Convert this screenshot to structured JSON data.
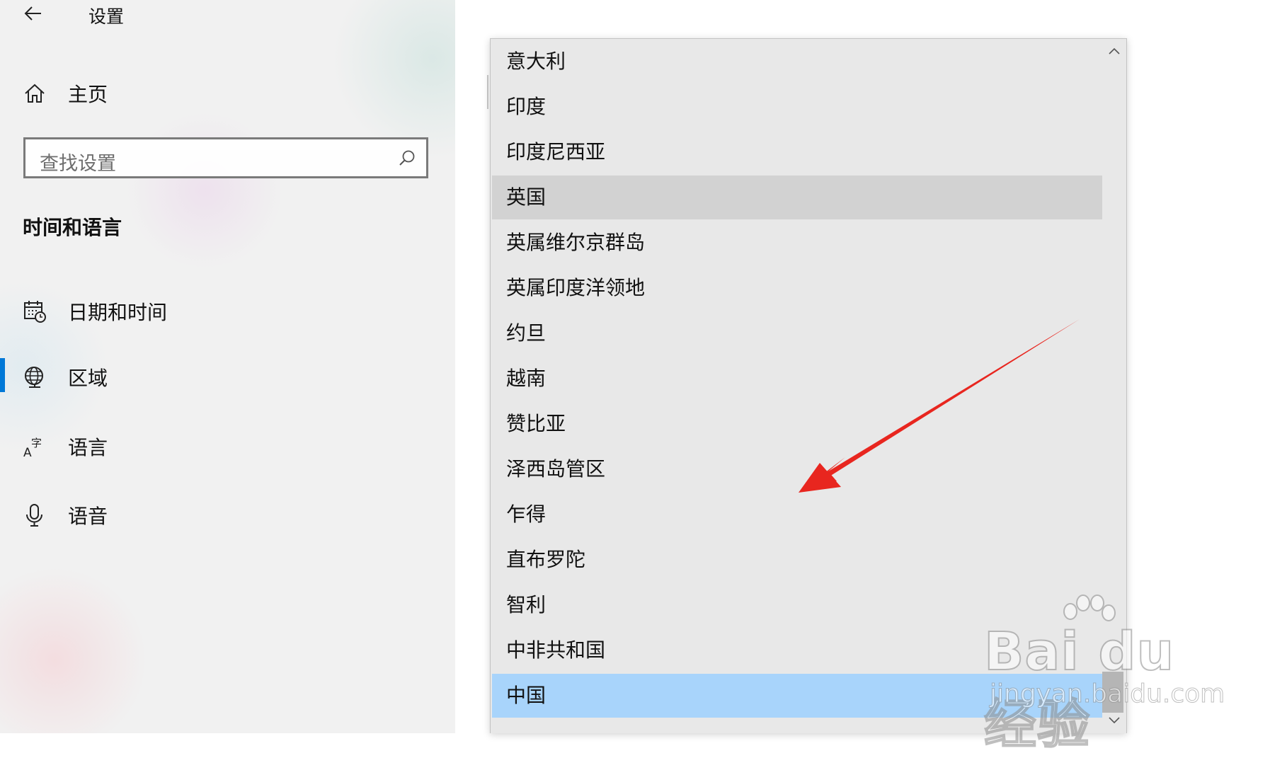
{
  "app": {
    "title": "设置"
  },
  "sidebar": {
    "home_label": "主页",
    "search_placeholder": "查找设置",
    "section_heading": "时间和语言",
    "items": [
      {
        "label": "日期和时间",
        "icon": "calendar-clock-icon",
        "active": false
      },
      {
        "label": "区域",
        "icon": "globe-icon",
        "active": true
      },
      {
        "label": "语言",
        "icon": "language-icon",
        "active": false
      },
      {
        "label": "语音",
        "icon": "microphone-icon",
        "active": false
      }
    ]
  },
  "dropdown": {
    "options": [
      "意大利",
      "印度",
      "印度尼西亚",
      "英国",
      "英属维尔京群岛",
      "英属印度洋领地",
      "约旦",
      "越南",
      "赞比亚",
      "泽西岛管区",
      "乍得",
      "直布罗陀",
      "智利",
      "中非共和国",
      "中国"
    ],
    "hovered": "英国",
    "selected": "中国"
  },
  "annotation": {
    "arrow_color": "#e8261f"
  },
  "watermark": {
    "logo_text": "Bai du 经验",
    "sub_text": "jingyan.baidu.com"
  },
  "colors": {
    "accent": "#0078d7",
    "selected_bg": "#a8d4fb",
    "hover_bg": "#d2d2d2"
  }
}
